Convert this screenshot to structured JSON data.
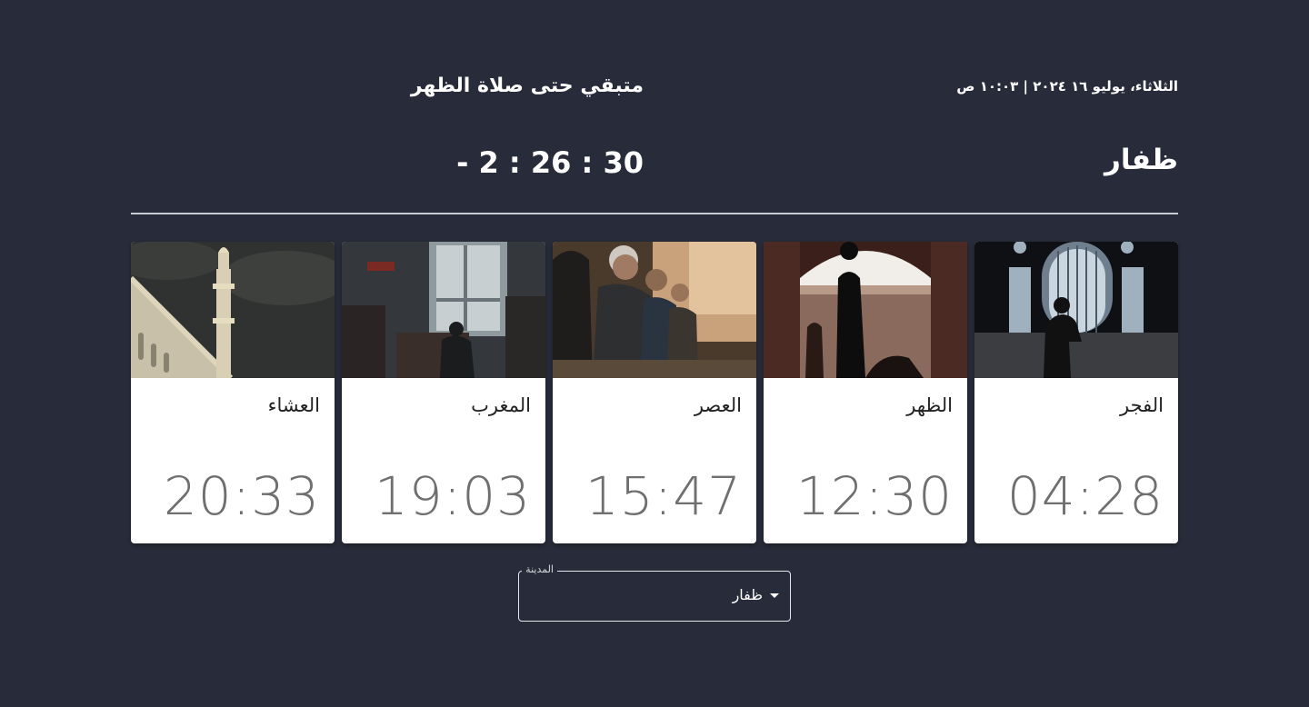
{
  "header": {
    "date": "الثلاثاء، يوليو ١٦ ٢٠٢٤ | ١٠:٠٣ ص",
    "city": "ظفار",
    "remaining_title": "متبقي حتى صلاة الظهر",
    "countdown": "- 2 : 26 : 30"
  },
  "prayers": [
    {
      "name": "الفجر",
      "time": "04:28",
      "image": "prayer-in-mosque-window-photo"
    },
    {
      "name": "الظهر",
      "time": "12:30",
      "image": "man-standing-in-arch-photo"
    },
    {
      "name": "العصر",
      "time": "15:47",
      "image": "men-sitting-in-row-photo"
    },
    {
      "name": "المغرب",
      "time": "19:03",
      "image": "man-sitting-by-window-photo"
    },
    {
      "name": "العشاء",
      "time": "20:33",
      "image": "minaret-under-cloudy-sky-photo"
    }
  ],
  "city_select": {
    "label": "المدينة",
    "value": "ظفار",
    "icon": "caret-down-icon"
  },
  "colors": {
    "background": "#282c3a",
    "card": "#ffffff",
    "time_text": "#6f6f6f"
  }
}
